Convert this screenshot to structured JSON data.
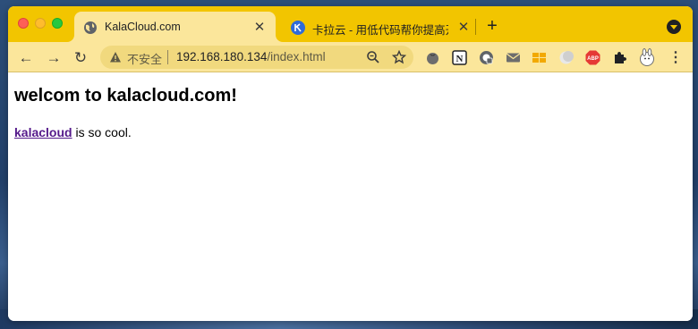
{
  "browser": {
    "tabs": [
      {
        "title": "KalaCloud.com",
        "active": true,
        "favicon": "globe-icon"
      },
      {
        "title": "卡拉云 - 用低代码帮你提高开发效率",
        "active": false,
        "favicon": "kalacloud-logo-icon"
      }
    ],
    "address_bar": {
      "security_label": "不安全",
      "url_host": "192.168.180.134",
      "url_path": "/index.html"
    },
    "colors": {
      "tabstrip": "#f2c500",
      "toolbar": "#fbe69b",
      "omnibox": "#f1d97e"
    },
    "extensions": [
      "tomato-icon",
      "notion-icon",
      "password-manager-icon",
      "mail-icon",
      "grid-icon",
      "moon-icon",
      "abp-icon",
      "puzzle-icon",
      "bunny-avatar-icon"
    ],
    "extension_abp_label": "ABP",
    "extension_notion_label": "N"
  },
  "page": {
    "heading": "welcom to kalacloud.com!",
    "link_text": "kalacloud",
    "text_after_link": " is so cool.",
    "link_color": "#551a8b"
  }
}
